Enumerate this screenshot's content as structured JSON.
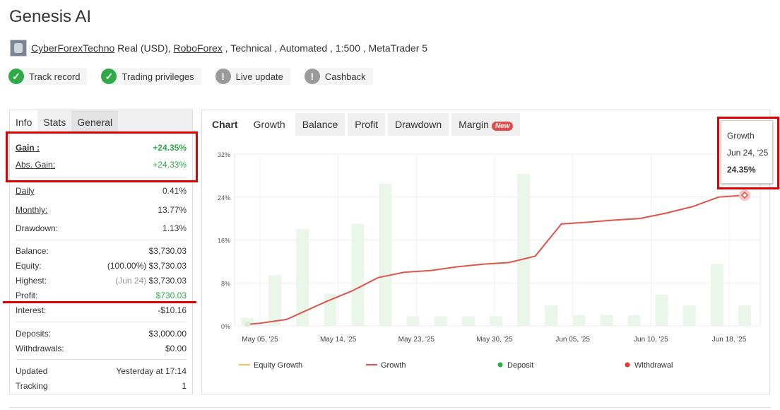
{
  "title": "Genesis AI",
  "meta": {
    "author": "CyberForexTechno",
    "account_type": " Real (USD), ",
    "broker": "RoboForex",
    "rest": " , Technical , Automated , 1:500 , MetaTrader 5"
  },
  "badges": [
    {
      "label": "Track record",
      "icon": "check-icon"
    },
    {
      "label": "Trading privileges",
      "icon": "check-icon"
    },
    {
      "label": "Live update",
      "icon": "exclamation-icon"
    },
    {
      "label": "Cashback",
      "icon": "exclamation-icon"
    }
  ],
  "left_tabs": [
    "Info",
    "Stats",
    "General"
  ],
  "stats": {
    "gain_label": "Gain :",
    "gain_value": "+24.35%",
    "abs_gain_label": "Abs. Gain:",
    "abs_gain_value": "+24.33%",
    "daily_label": "Daily",
    "daily_value": "0.41%",
    "monthly_label": "Monthly:",
    "monthly_value": "13.77%",
    "drawdown_label": "Drawdown:",
    "drawdown_value": "1.13%",
    "balance_label": "Balance:",
    "balance_value": "$3,730.03",
    "equity_label": "Equity:",
    "equity_prefix": "(100.00%)",
    "equity_value": "$3,730.03",
    "highest_label": "Highest:",
    "highest_prefix": "(Jun 24)",
    "highest_value": "$3,730.03",
    "profit_label": "Profit:",
    "profit_value": "$730.03",
    "interest_label": "Interest:",
    "interest_value": "-$10.16",
    "deposits_label": "Deposits:",
    "deposits_value": "$3,000.00",
    "withdrawals_label": "Withdrawals:",
    "withdrawals_value": "$0.00",
    "updated_label": "Updated",
    "updated_value": "Yesterday at 17:14",
    "tracking_label": "Tracking",
    "tracking_value": "1"
  },
  "chart_tabs": {
    "label": "Chart",
    "tabs": [
      "Growth",
      "Balance",
      "Profit",
      "Drawdown",
      "Margin"
    ],
    "new_badge": "New"
  },
  "tooltip": {
    "series": "Growth",
    "date": "Jun 24, '25",
    "value": "24.35%"
  },
  "colors": {
    "growth": "#e0544a",
    "deposit": "#2eaa46",
    "withdrawal": "#e03a3a",
    "equity": "#f2c14e",
    "bars": "#eaf6ea",
    "highlight": "#e00000"
  },
  "chart_data": {
    "type": "line",
    "y_ticks": [
      "32%",
      "24%",
      "16%",
      "8%",
      "0%"
    ],
    "x_ticks": [
      "May 05, '25",
      "May 14, '25",
      "May 23, '25",
      "May 30, '25",
      "Jun 05, '25",
      "Jun 10, '25",
      "Jun 18, '25"
    ],
    "ylim": [
      0,
      32
    ],
    "series": [
      {
        "name": "Growth",
        "x": [
          0,
          0.5,
          1.5,
          3,
          4,
          5,
          6,
          7,
          8,
          9,
          10,
          11,
          12,
          13,
          14,
          15,
          16,
          17,
          18,
          19
        ],
        "y": [
          0.3,
          0.5,
          1.2,
          4.5,
          6.5,
          9.0,
          10.0,
          10.3,
          11.0,
          11.5,
          11.8,
          13.0,
          19.0,
          19.3,
          19.7,
          20.0,
          21.0,
          22.2,
          24.0,
          24.35
        ]
      }
    ],
    "bars": [
      1.5,
      9.5,
      18,
      6,
      19,
      26.5,
      1.8,
      1.8,
      1.8,
      1.8,
      28.3,
      3.8,
      2,
      2,
      2,
      5.8,
      3.8,
      11.5,
      3.8
    ],
    "legend": [
      "Equity Growth",
      "Growth",
      "Deposit",
      "Withdrawal"
    ]
  }
}
